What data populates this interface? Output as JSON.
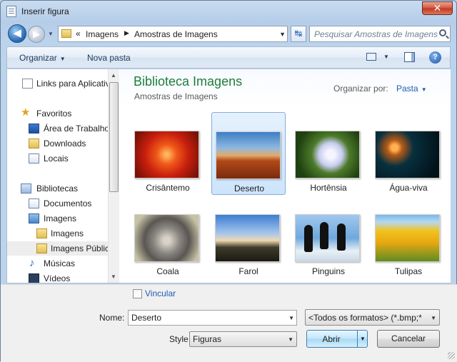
{
  "window": {
    "title": "Inserir figura",
    "close_label": "✕"
  },
  "nav": {
    "back_glyph": "◀",
    "forward_glyph": "▶",
    "history_glyph": "▼",
    "refresh_glyph": "↹",
    "address": {
      "chevron": "«",
      "segments": [
        "Imagens",
        "Amostras de Imagens"
      ],
      "separator": "▶",
      "drop_glyph": "▼"
    },
    "search_placeholder": "Pesquisar Amostras de Imagens"
  },
  "toolbar": {
    "organize_label": "Organizar",
    "new_folder_label": "Nova pasta",
    "drop_glyph": "▼",
    "help_label": "?"
  },
  "sidebar": {
    "items": [
      {
        "label": "Links para Aplicativos"
      },
      {
        "label": "Favoritos"
      },
      {
        "label": "Área de Trabalho"
      },
      {
        "label": "Downloads"
      },
      {
        "label": "Locais"
      },
      {
        "label": "Bibliotecas"
      },
      {
        "label": "Documentos"
      },
      {
        "label": "Imagens"
      },
      {
        "label": "Imagens"
      },
      {
        "label": "Imagens Públicas"
      },
      {
        "label": "Músicas"
      },
      {
        "label": "Vídeos"
      }
    ],
    "scroll_up": "▲",
    "scroll_down": "▼"
  },
  "library": {
    "title": "Biblioteca Imagens",
    "subtitle": "Amostras de Imagens",
    "arrange_label": "Organizar por:",
    "arrange_value": "Pasta",
    "arrange_glyph": "▼"
  },
  "files": [
    {
      "name": "Crisântemo"
    },
    {
      "name": "Deserto"
    },
    {
      "name": "Hortênsia"
    },
    {
      "name": "Água-viva"
    },
    {
      "name": "Coala"
    },
    {
      "name": "Farol"
    },
    {
      "name": "Pinguins"
    },
    {
      "name": "Tulipas"
    }
  ],
  "form": {
    "link_label": "Vincular",
    "name_label": "Nome:",
    "name_value": "Deserto",
    "format_value": "<Todos os formatos> (*.bmp;*",
    "style_label": "Style",
    "style_value": "Figuras",
    "open_label": "Abrir",
    "cancel_label": "Cancelar",
    "drop_glyph": "▼"
  },
  "colors": {
    "accent": "#1e5db3",
    "library_title": "#1e7d3a",
    "selection": "#cde4fb"
  }
}
